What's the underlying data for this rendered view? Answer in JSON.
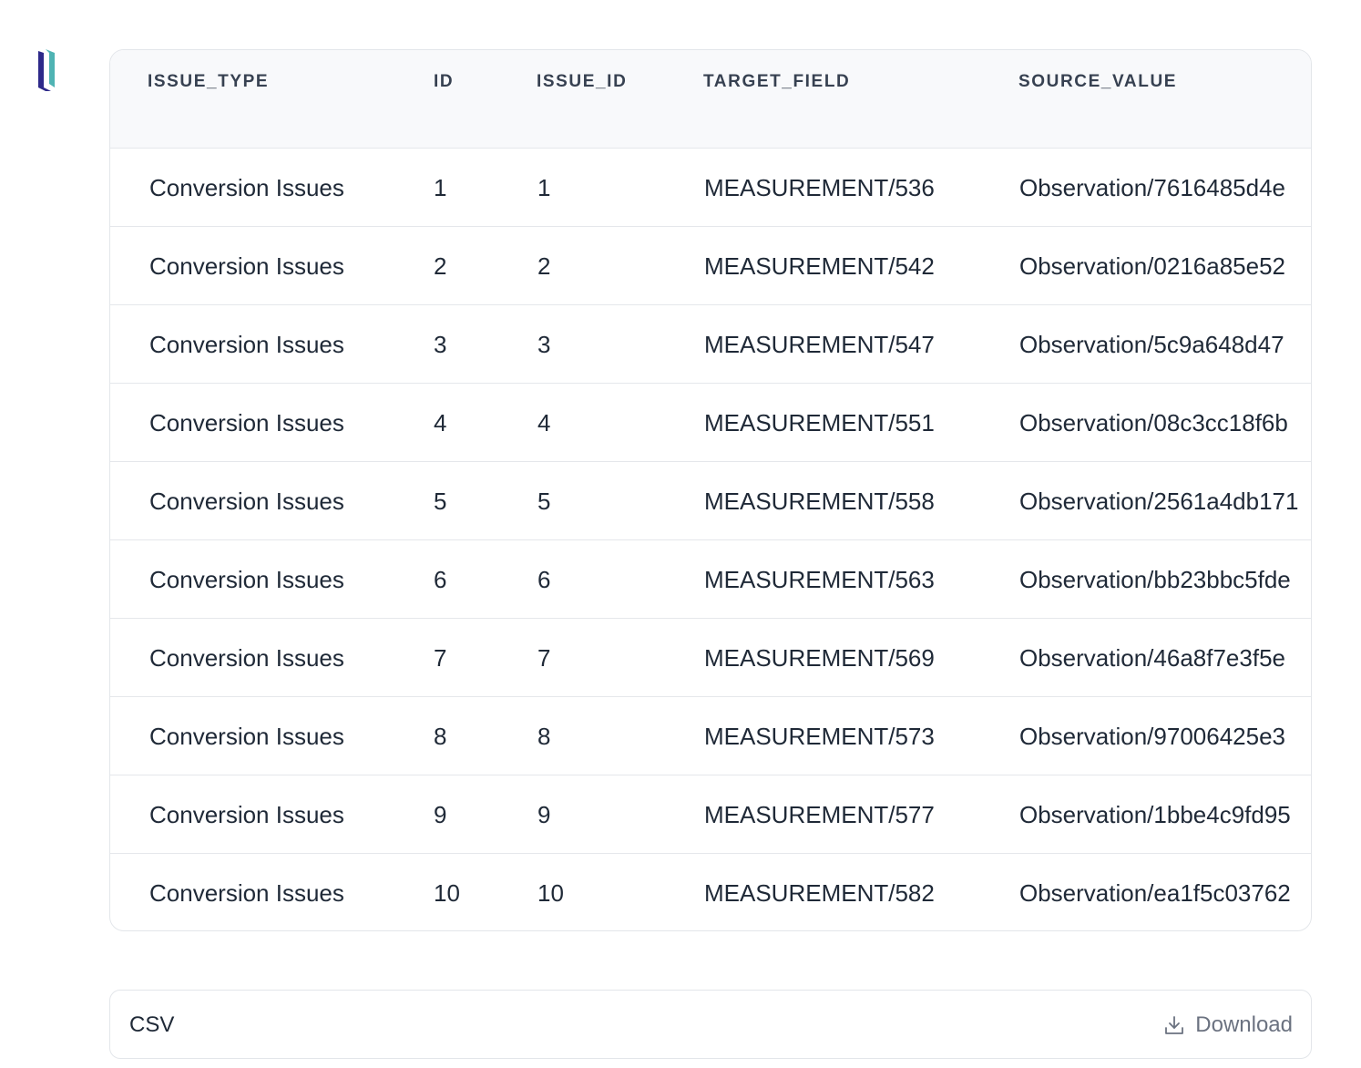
{
  "logo": {
    "name": "brand-logo",
    "colors": {
      "primary": "#2e2a8a",
      "accent": "#4fb3b3"
    }
  },
  "table": {
    "columns": [
      "ISSUE_TYPE",
      "ID",
      "ISSUE_ID",
      "TARGET_FIELD",
      "SOURCE_VALUE"
    ],
    "rows": [
      [
        "Conversion Issues",
        "1",
        "1",
        "MEASUREMENT/536",
        "Observation/7616485d4e"
      ],
      [
        "Conversion Issues",
        "2",
        "2",
        "MEASUREMENT/542",
        "Observation/0216a85e52"
      ],
      [
        "Conversion Issues",
        "3",
        "3",
        "MEASUREMENT/547",
        "Observation/5c9a648d47"
      ],
      [
        "Conversion Issues",
        "4",
        "4",
        "MEASUREMENT/551",
        "Observation/08c3cc18f6b"
      ],
      [
        "Conversion Issues",
        "5",
        "5",
        "MEASUREMENT/558",
        "Observation/2561a4db171"
      ],
      [
        "Conversion Issues",
        "6",
        "6",
        "MEASUREMENT/563",
        "Observation/bb23bbc5fde"
      ],
      [
        "Conversion Issues",
        "7",
        "7",
        "MEASUREMENT/569",
        "Observation/46a8f7e3f5e"
      ],
      [
        "Conversion Issues",
        "8",
        "8",
        "MEASUREMENT/573",
        "Observation/97006425e3"
      ],
      [
        "Conversion Issues",
        "9",
        "9",
        "MEASUREMENT/577",
        "Observation/1bbe4c9fd95"
      ],
      [
        "Conversion Issues",
        "10",
        "10",
        "MEASUREMENT/582",
        "Observation/ea1f5c03762"
      ]
    ]
  },
  "export": {
    "format_label": "CSV",
    "download_label": "Download",
    "download_icon": "download-icon"
  }
}
